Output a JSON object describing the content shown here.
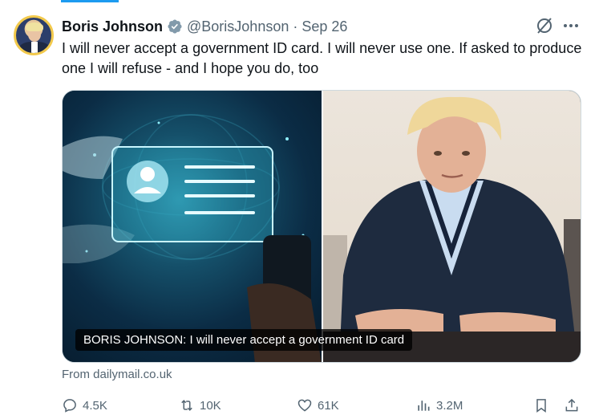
{
  "tweet": {
    "author_name": "Boris Johnson",
    "handle": "@BorisJohnson",
    "separator": "·",
    "date": "Sep 26",
    "verified": true,
    "text": "I will never accept a government ID card. I will never use one. If asked to produce one I will refuse - and I hope you do, too"
  },
  "media": {
    "caption": "BORIS JOHNSON: I will never accept a government ID card",
    "source": "From dailymail.co.uk"
  },
  "actions": {
    "replies": "4.5K",
    "reposts": "10K",
    "likes": "61K",
    "views": "3.2M"
  },
  "icons": {
    "verified": "verified-badge-icon",
    "grok": "grok-icon",
    "more": "more-horizontal-icon",
    "reply": "reply-icon",
    "repost": "repost-icon",
    "like": "heart-icon",
    "views": "views-chart-icon",
    "bookmark": "bookmark-icon",
    "share": "share-icon"
  },
  "colors": {
    "accent": "#1d9bf0",
    "text": "#0f1419",
    "secondary": "#536471",
    "avatar_ring": "#f2c94c"
  }
}
